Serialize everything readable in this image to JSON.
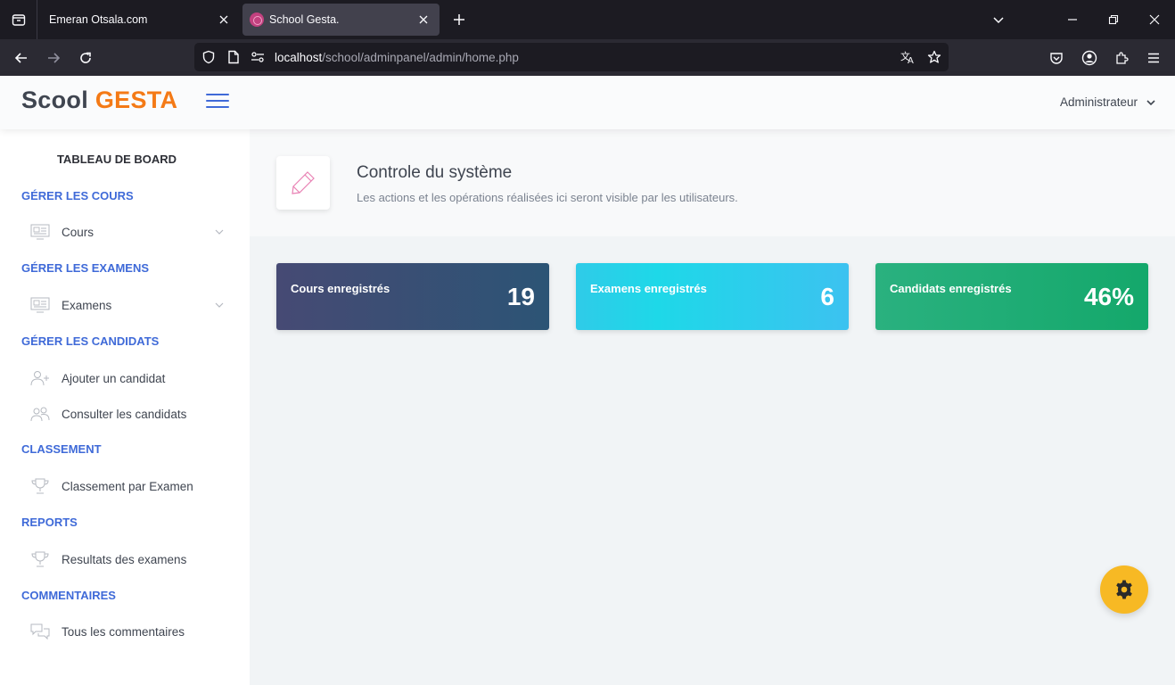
{
  "browser": {
    "tabs": [
      {
        "title": "Emeran Otsala.com",
        "active": false
      },
      {
        "title": "School Gesta.",
        "active": true
      }
    ],
    "url_host": "localhost",
    "url_path": "/school/adminpanel/admin/home.php"
  },
  "header": {
    "logo_main": "Scool",
    "logo_accent": "GESTA",
    "user_label": "Administrateur"
  },
  "sidebar": {
    "dashboard_title": "TABLEAU DE BOARD",
    "sections": [
      {
        "heading": "GÉRER LES COURS",
        "items": [
          {
            "label": "Cours",
            "icon": "monitor-icon",
            "has_submenu": true
          }
        ]
      },
      {
        "heading": "GÉRER LES EXAMENS",
        "items": [
          {
            "label": "Examens",
            "icon": "monitor-icon",
            "has_submenu": true
          }
        ]
      },
      {
        "heading": "GÉRER LES CANDIDATS",
        "items": [
          {
            "label": "Ajouter un candidat",
            "icon": "add-user-icon",
            "has_submenu": false
          },
          {
            "label": "Consulter les candidats",
            "icon": "users-icon",
            "has_submenu": false
          }
        ]
      },
      {
        "heading": "CLASSEMENT",
        "items": [
          {
            "label": "Classement par Examen",
            "icon": "trophy-icon",
            "has_submenu": false
          }
        ]
      },
      {
        "heading": "REPORTS",
        "items": [
          {
            "label": "Resultats des examens",
            "icon": "trophy-icon",
            "has_submenu": false
          }
        ]
      },
      {
        "heading": "COMMENTAIRES",
        "items": [
          {
            "label": "Tous les commentaires",
            "icon": "chat-icon",
            "has_submenu": false
          }
        ]
      }
    ]
  },
  "page": {
    "icon": "pencil-icon",
    "title": "Controle du système",
    "subtitle": "Les actions et les opérations réalisées ici seront visible par les utilisateurs."
  },
  "stats": [
    {
      "label": "Cours enregistrés",
      "value": "19"
    },
    {
      "label": "Examens enregistrés",
      "value": "6"
    },
    {
      "label": "Candidats enregistrés",
      "value": "46%"
    }
  ],
  "colors": {
    "accent": "#3f6ad8",
    "logo_accent": "#f47a16",
    "card_cours": "#3a4f75",
    "card_examens": "#2ccbe9",
    "card_candidats": "#1fab74",
    "settings_button": "#f7b924"
  }
}
